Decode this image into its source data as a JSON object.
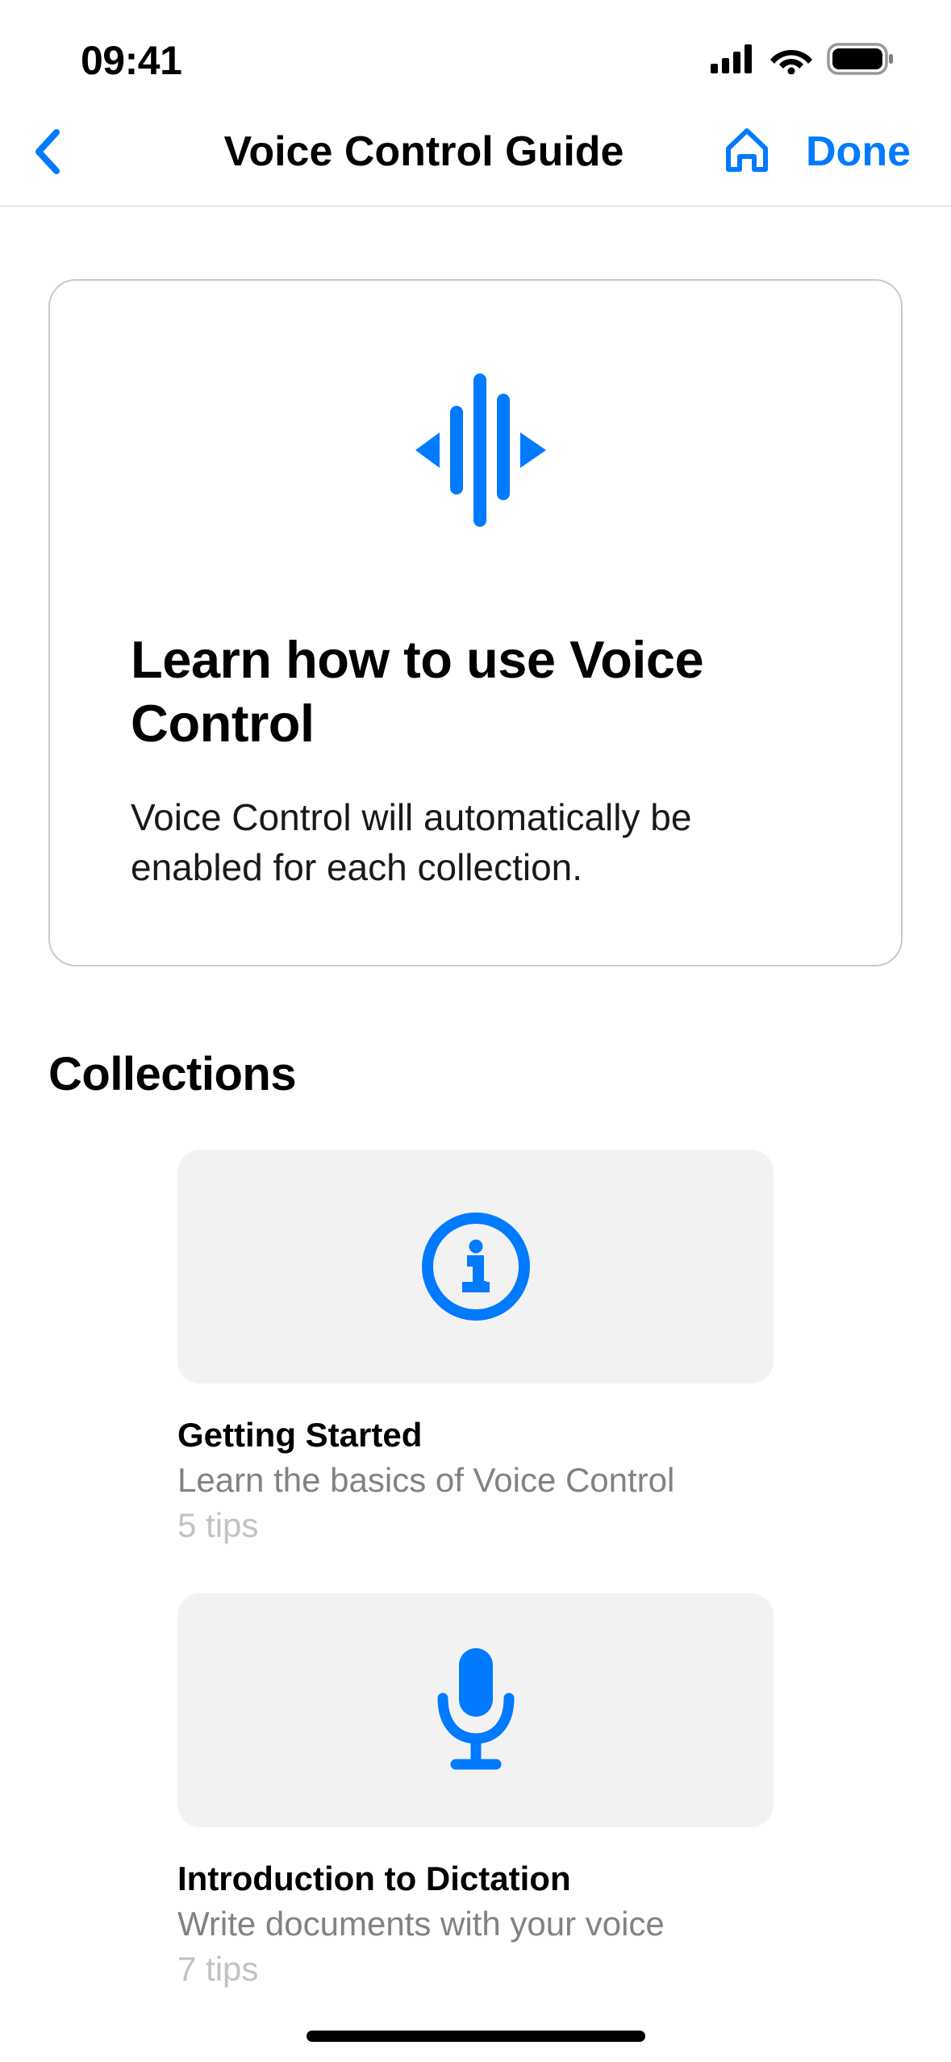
{
  "status": {
    "time": "09:41"
  },
  "nav": {
    "title": "Voice Control Guide",
    "done_label": "Done"
  },
  "hero": {
    "title": "Learn how to use Voice Control",
    "subtitle": "Voice Control will automatically be enabled for each collection."
  },
  "collections_heading": "Collections",
  "collections": [
    {
      "title": "Getting Started",
      "desc": "Learn the basics of Voice Control",
      "tips": "5 tips",
      "icon": "info"
    },
    {
      "title": "Introduction to Dictation",
      "desc": "Write documents with your voice",
      "tips": "7 tips",
      "icon": "mic"
    }
  ],
  "colors": {
    "accent": "#007AFF"
  }
}
